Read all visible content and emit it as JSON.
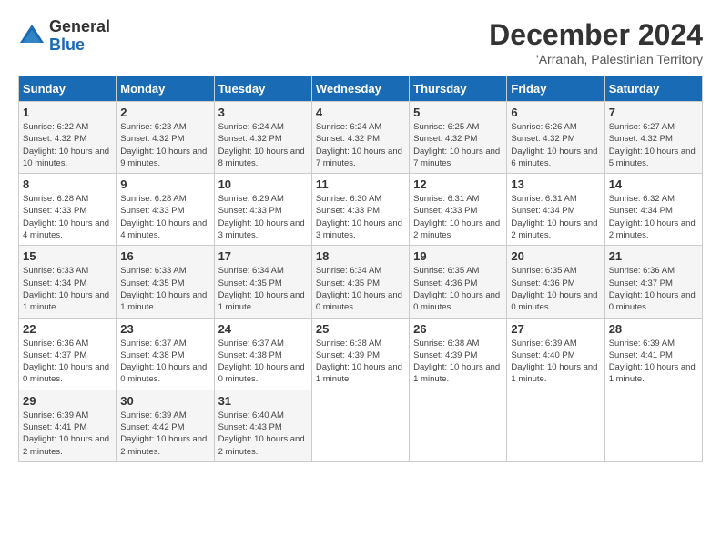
{
  "logo": {
    "general": "General",
    "blue": "Blue"
  },
  "header": {
    "month": "December 2024",
    "location": "'Arranah, Palestinian Territory"
  },
  "days_of_week": [
    "Sunday",
    "Monday",
    "Tuesday",
    "Wednesday",
    "Thursday",
    "Friday",
    "Saturday"
  ],
  "weeks": [
    [
      {
        "day": "1",
        "sunrise": "6:22 AM",
        "sunset": "4:32 PM",
        "daylight": "10 hours and 10 minutes."
      },
      {
        "day": "2",
        "sunrise": "6:23 AM",
        "sunset": "4:32 PM",
        "daylight": "10 hours and 9 minutes."
      },
      {
        "day": "3",
        "sunrise": "6:24 AM",
        "sunset": "4:32 PM",
        "daylight": "10 hours and 8 minutes."
      },
      {
        "day": "4",
        "sunrise": "6:24 AM",
        "sunset": "4:32 PM",
        "daylight": "10 hours and 7 minutes."
      },
      {
        "day": "5",
        "sunrise": "6:25 AM",
        "sunset": "4:32 PM",
        "daylight": "10 hours and 7 minutes."
      },
      {
        "day": "6",
        "sunrise": "6:26 AM",
        "sunset": "4:32 PM",
        "daylight": "10 hours and 6 minutes."
      },
      {
        "day": "7",
        "sunrise": "6:27 AM",
        "sunset": "4:32 PM",
        "daylight": "10 hours and 5 minutes."
      }
    ],
    [
      {
        "day": "8",
        "sunrise": "6:28 AM",
        "sunset": "4:33 PM",
        "daylight": "10 hours and 4 minutes."
      },
      {
        "day": "9",
        "sunrise": "6:28 AM",
        "sunset": "4:33 PM",
        "daylight": "10 hours and 4 minutes."
      },
      {
        "day": "10",
        "sunrise": "6:29 AM",
        "sunset": "4:33 PM",
        "daylight": "10 hours and 3 minutes."
      },
      {
        "day": "11",
        "sunrise": "6:30 AM",
        "sunset": "4:33 PM",
        "daylight": "10 hours and 3 minutes."
      },
      {
        "day": "12",
        "sunrise": "6:31 AM",
        "sunset": "4:33 PM",
        "daylight": "10 hours and 2 minutes."
      },
      {
        "day": "13",
        "sunrise": "6:31 AM",
        "sunset": "4:34 PM",
        "daylight": "10 hours and 2 minutes."
      },
      {
        "day": "14",
        "sunrise": "6:32 AM",
        "sunset": "4:34 PM",
        "daylight": "10 hours and 2 minutes."
      }
    ],
    [
      {
        "day": "15",
        "sunrise": "6:33 AM",
        "sunset": "4:34 PM",
        "daylight": "10 hours and 1 minute."
      },
      {
        "day": "16",
        "sunrise": "6:33 AM",
        "sunset": "4:35 PM",
        "daylight": "10 hours and 1 minute."
      },
      {
        "day": "17",
        "sunrise": "6:34 AM",
        "sunset": "4:35 PM",
        "daylight": "10 hours and 1 minute."
      },
      {
        "day": "18",
        "sunrise": "6:34 AM",
        "sunset": "4:35 PM",
        "daylight": "10 hours and 0 minutes."
      },
      {
        "day": "19",
        "sunrise": "6:35 AM",
        "sunset": "4:36 PM",
        "daylight": "10 hours and 0 minutes."
      },
      {
        "day": "20",
        "sunrise": "6:35 AM",
        "sunset": "4:36 PM",
        "daylight": "10 hours and 0 minutes."
      },
      {
        "day": "21",
        "sunrise": "6:36 AM",
        "sunset": "4:37 PM",
        "daylight": "10 hours and 0 minutes."
      }
    ],
    [
      {
        "day": "22",
        "sunrise": "6:36 AM",
        "sunset": "4:37 PM",
        "daylight": "10 hours and 0 minutes."
      },
      {
        "day": "23",
        "sunrise": "6:37 AM",
        "sunset": "4:38 PM",
        "daylight": "10 hours and 0 minutes."
      },
      {
        "day": "24",
        "sunrise": "6:37 AM",
        "sunset": "4:38 PM",
        "daylight": "10 hours and 0 minutes."
      },
      {
        "day": "25",
        "sunrise": "6:38 AM",
        "sunset": "4:39 PM",
        "daylight": "10 hours and 1 minute."
      },
      {
        "day": "26",
        "sunrise": "6:38 AM",
        "sunset": "4:39 PM",
        "daylight": "10 hours and 1 minute."
      },
      {
        "day": "27",
        "sunrise": "6:39 AM",
        "sunset": "4:40 PM",
        "daylight": "10 hours and 1 minute."
      },
      {
        "day": "28",
        "sunrise": "6:39 AM",
        "sunset": "4:41 PM",
        "daylight": "10 hours and 1 minute."
      }
    ],
    [
      {
        "day": "29",
        "sunrise": "6:39 AM",
        "sunset": "4:41 PM",
        "daylight": "10 hours and 2 minutes."
      },
      {
        "day": "30",
        "sunrise": "6:39 AM",
        "sunset": "4:42 PM",
        "daylight": "10 hours and 2 minutes."
      },
      {
        "day": "31",
        "sunrise": "6:40 AM",
        "sunset": "4:43 PM",
        "daylight": "10 hours and 2 minutes."
      },
      null,
      null,
      null,
      null
    ]
  ]
}
